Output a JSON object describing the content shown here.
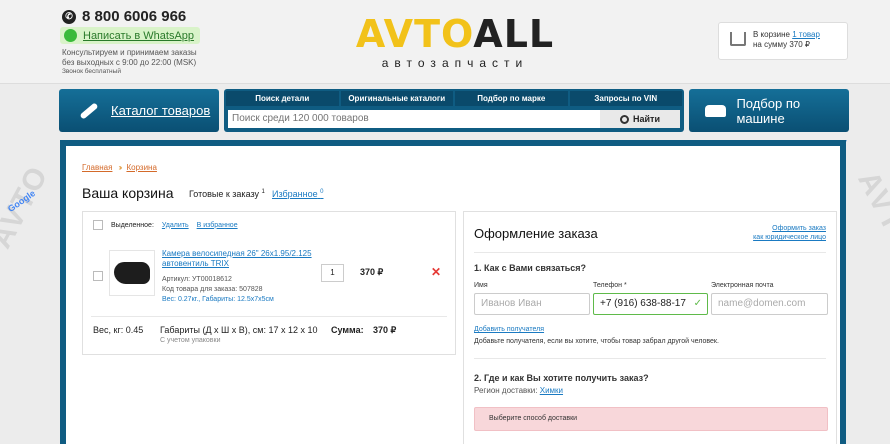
{
  "header": {
    "phone": "8 800 6006 966",
    "whatsapp": "Написать в WhatsApp",
    "hours_line1": "Консультируем и принимаем заказы",
    "hours_line2": "без выходных с 9:00 до 22:00 (MSK)",
    "free_call": "Звонок бесплатный",
    "logo_part1": "AVTO",
    "logo_part2": "ALL",
    "logo_sub": "автозапчасти",
    "cart_prefix": "В корзине",
    "cart_count": "1 товар",
    "cart_sum": "на сумму 370 ₽"
  },
  "nav": {
    "catalog": "Каталог товаров",
    "tabs": [
      "Поиск детали",
      "Оригинальные каталоги",
      "Подбор по марке",
      "Запросы по VIN"
    ],
    "search_placeholder": "Поиск среди 120 000 товаров",
    "search_button": "Найти",
    "by_car": "Подбор по машине"
  },
  "breadcrumb": {
    "home": "Главная",
    "current": "Корзина"
  },
  "page": {
    "title": "Ваша корзина",
    "tab_ready": "Готовые к заказу",
    "tab_ready_count": "1",
    "tab_fav": "Избранное",
    "tab_fav_count": "0"
  },
  "cart": {
    "selected_label": "Выделенное:",
    "delete": "Удалить",
    "to_fav": "В избранное",
    "item": {
      "name": "Камера велосипедная 26\" 26х1.95/2.125 автовентиль TRIX",
      "article": "Артикул: УТ00018612",
      "code": "Код товара для заказа: 507828",
      "weight": "Вес: 0.27кг., Габариты: 12.5х7х5см",
      "qty": "1",
      "price": "370 ₽"
    },
    "summary": {
      "weight": "Вес, кг: 0.45",
      "dims": "Габариты (Д х Ш х В), см: 17 х 12 х 10",
      "packing": "С учетом упаковки",
      "total_label": "Сумма:",
      "total": "370 ₽"
    }
  },
  "order": {
    "title": "Оформление заказа",
    "legal_line1": "Оформить заказ",
    "legal_line2": "как юридическое лицо",
    "section1": "1. Как с Вами связаться?",
    "name_label": "Имя",
    "name_placeholder": "Иванов Иван",
    "phone_label": "Телефон *",
    "phone_value": "+7 (916) 638-88-17",
    "email_label": "Электронная почта",
    "email_placeholder": "name@domen.com",
    "add_recipient": "Добавить получателя",
    "add_hint": "Добавьте получателя, если вы хотите, чтобы товар забрал другой человек.",
    "section2": "2. Где и как Вы хотите получить заказ?",
    "region_label": "Регион доставки:",
    "region_value": "Химки",
    "delivery_alert": "Выберите способ доставки"
  },
  "colors": {
    "brand_blue": "#0f5c82",
    "logo_yellow": "#f2c21a",
    "link": "#1a7ac2",
    "ok_green": "#5fba4a"
  }
}
